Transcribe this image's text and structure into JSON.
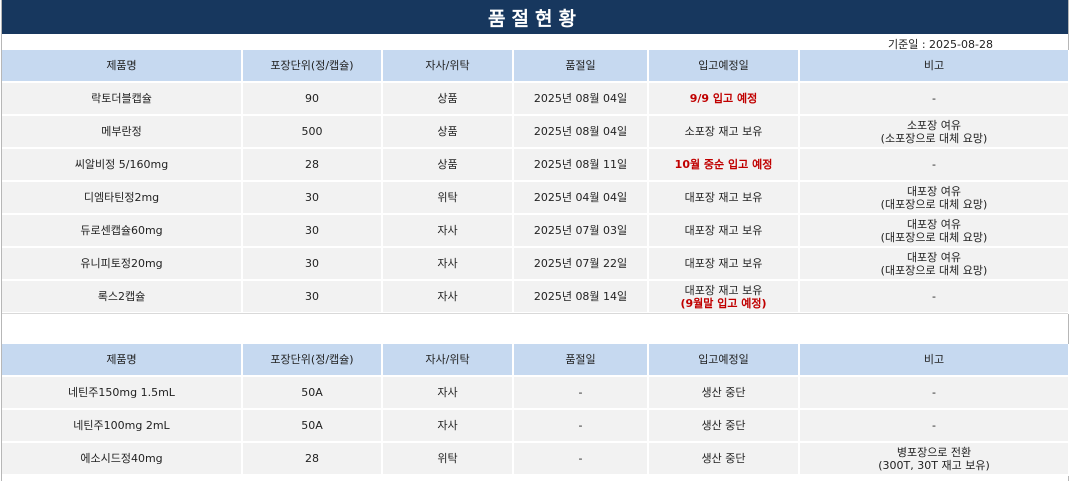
{
  "title": "품절현황",
  "base_date": "기준일 : 2025-08-28",
  "headers": [
    "제품명",
    "포장단위(정/캡슐)",
    "자사/위탁",
    "품절일",
    "입고예정일",
    "비고"
  ],
  "table1": [
    {
      "name": "락토더블캡슐",
      "pack": "90",
      "type": "상품",
      "soldout": "2025년 08월 04일",
      "restock": "9/9 입고 예정",
      "restock2": "",
      "restock_red": true,
      "note1": "-",
      "note2": ""
    },
    {
      "name": "메부란정",
      "pack": "500",
      "type": "상품",
      "soldout": "2025년 08월 04일",
      "restock": "소포장 재고 보유",
      "restock2": "",
      "restock_red": false,
      "note1": "소포장 여유",
      "note2": "(소포장으로 대체 요망)"
    },
    {
      "name": "씨알비정 5/160mg",
      "pack": "28",
      "type": "상품",
      "soldout": "2025년 08월 11일",
      "restock": "10월 중순 입고 예정",
      "restock2": "",
      "restock_red": true,
      "note1": "-",
      "note2": ""
    },
    {
      "name": "디엠타틴정2mg",
      "pack": "30",
      "type": "위탁",
      "soldout": "2025년 04월 04일",
      "restock": "대포장 재고 보유",
      "restock2": "",
      "restock_red": false,
      "note1": "대포장 여유",
      "note2": "(대포장으로 대체 요망)"
    },
    {
      "name": "듀로센캡슐60mg",
      "pack": "30",
      "type": "자사",
      "soldout": "2025년 07월 03일",
      "restock": "대포장 재고 보유",
      "restock2": "",
      "restock_red": false,
      "note1": "대포장 여유",
      "note2": "(대포장으로 대체 요망)"
    },
    {
      "name": "유니피토정20mg",
      "pack": "30",
      "type": "자사",
      "soldout": "2025년 07월 22일",
      "restock": "대포장 재고 보유",
      "restock2": "",
      "restock_red": false,
      "note1": "대포장 여유",
      "note2": "(대포장으로 대체 요망)"
    },
    {
      "name": "록스2캡슐",
      "pack": "30",
      "type": "자사",
      "soldout": "2025년 08월 14일",
      "restock": "대포장 재고 보유",
      "restock2": "(9월말 입고 예정)",
      "restock_red": false,
      "note1": "-",
      "note2": ""
    }
  ],
  "table2": [
    {
      "name": "네틴주150mg 1.5mL",
      "pack": "50A",
      "type": "자사",
      "soldout": "-",
      "restock": "생산 중단",
      "note1": "-",
      "note2": ""
    },
    {
      "name": "네틴주100mg 2mL",
      "pack": "50A",
      "type": "자사",
      "soldout": "-",
      "restock": "생산 중단",
      "note1": "-",
      "note2": ""
    },
    {
      "name": "에소시드정40mg",
      "pack": "28",
      "type": "위탁",
      "soldout": "-",
      "restock": "생산 중단",
      "note1": "병포장으로 전환",
      "note2": "(300T, 30T 재고 보유)"
    }
  ]
}
